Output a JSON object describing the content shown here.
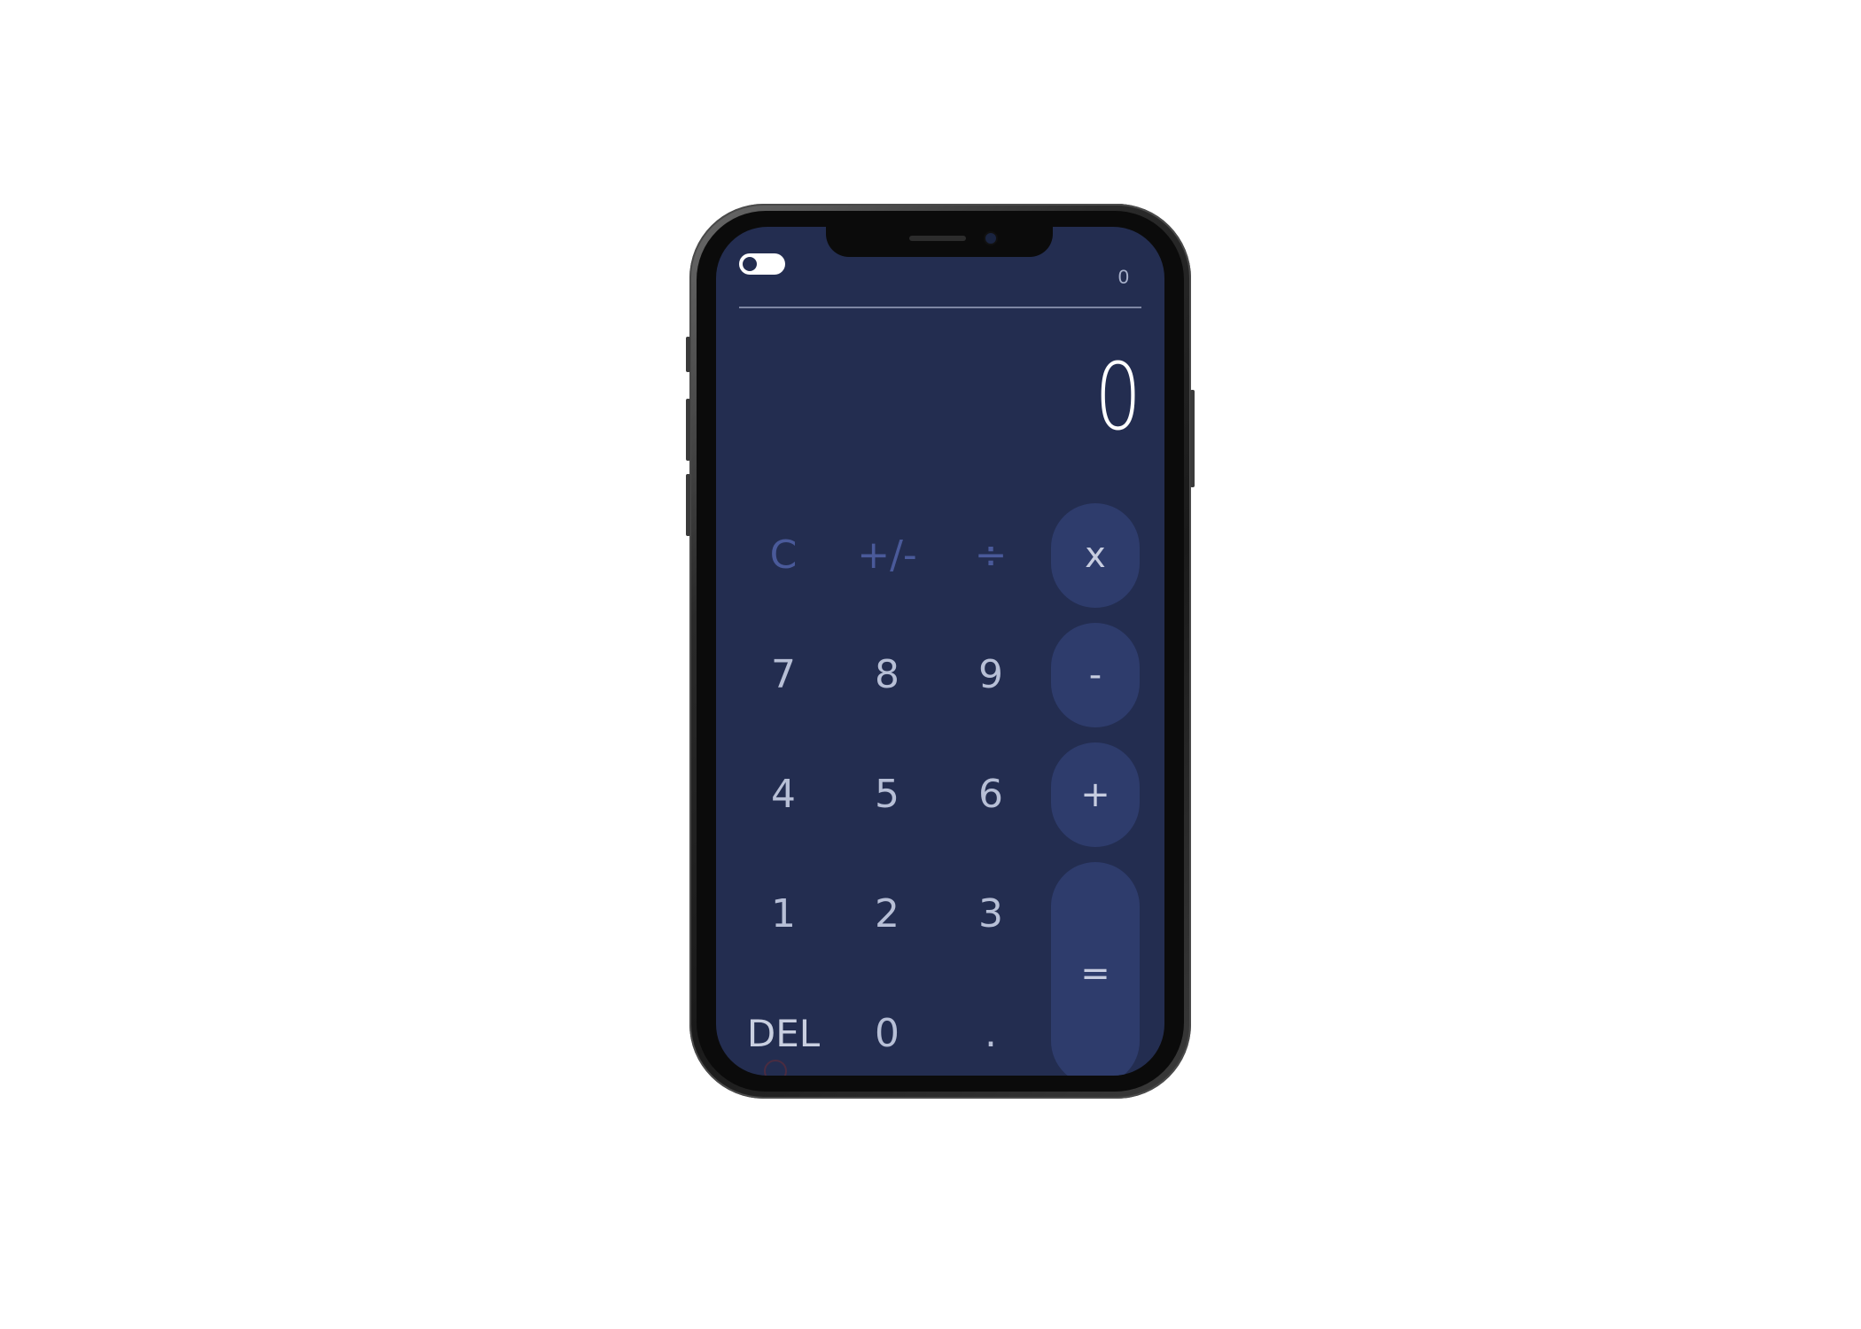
{
  "header": {
    "history": "0"
  },
  "display": {
    "value": "0"
  },
  "keys": {
    "clear": "C",
    "negate": "+/-",
    "divide": "÷",
    "multiply": "x",
    "seven": "7",
    "eight": "8",
    "nine": "9",
    "minus": "-",
    "four": "4",
    "five": "5",
    "six": "6",
    "plus": "+",
    "one": "1",
    "two": "2",
    "three": "3",
    "equals": "=",
    "delete": "DEL",
    "zero": "0",
    "decimal": "."
  },
  "theme": {
    "screen_bg": "#232d50",
    "operator_bg": "#2e3c6c",
    "function_key_color": "#4a5a9a",
    "digit_color": "#b7bfd6",
    "display_color": "#ffffff"
  },
  "icons": {
    "theme_toggle": "toggle-switch-icon"
  }
}
